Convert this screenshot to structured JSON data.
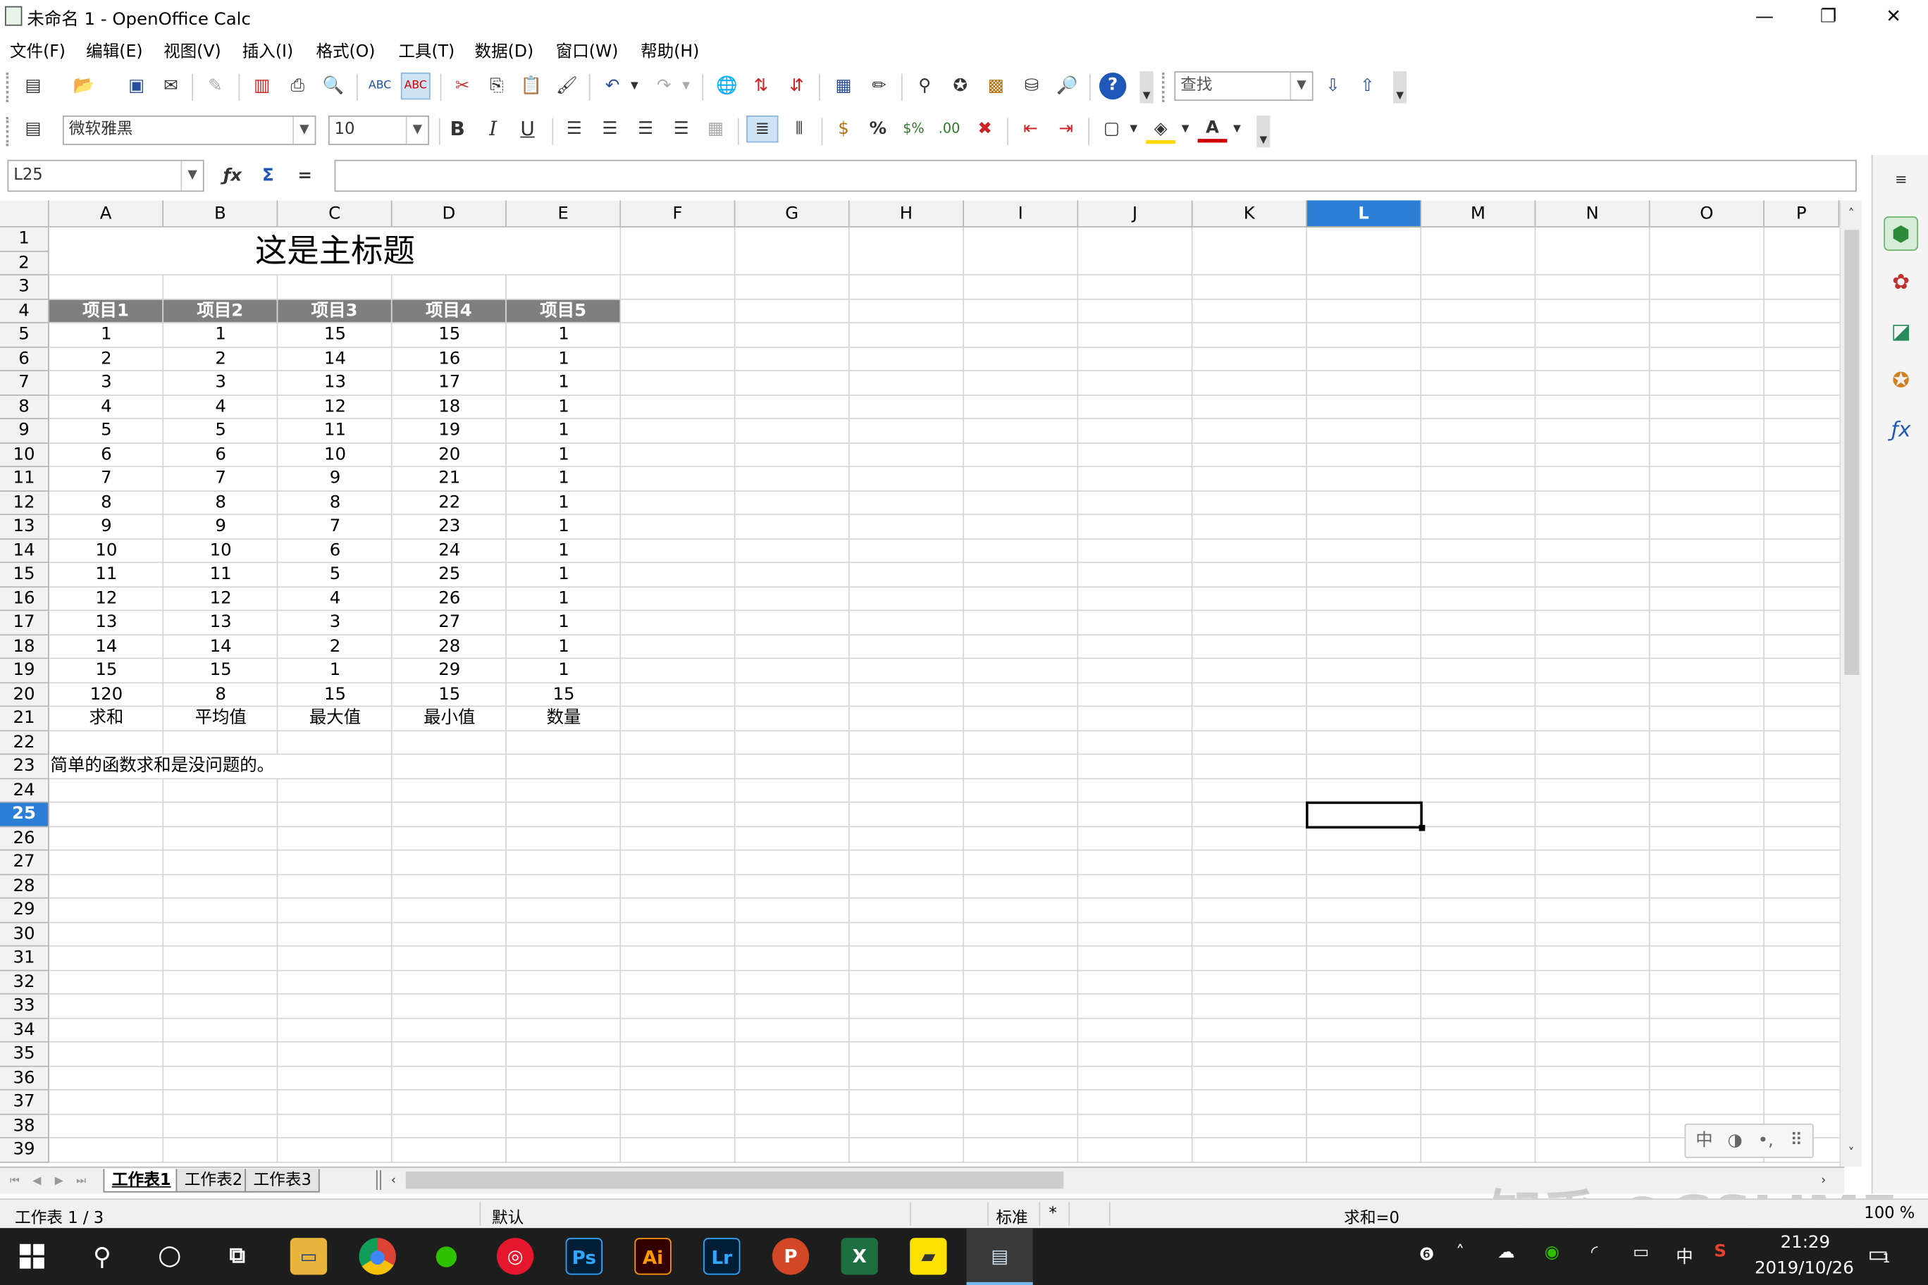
{
  "window": {
    "title": "未命名 1 - OpenOffice Calc",
    "min_label": "—",
    "max_label": "❐",
    "close_label": "✕"
  },
  "menu": [
    "文件(F)",
    "编辑(E)",
    "视图(V)",
    "插入(I)",
    "格式(O)",
    "工具(T)",
    "数据(D)",
    "窗口(W)",
    "帮助(H)"
  ],
  "toolbar": {
    "find_placeholder": "查找",
    "font_name": "微软雅黑",
    "font_size": "10",
    "bold": "B",
    "italic": "I",
    "underline": "U",
    "percent": "%"
  },
  "formula_bar": {
    "cell_ref": "L25",
    "fx": "ƒx",
    "sum": "Σ",
    "equals": "=",
    "value": ""
  },
  "columns": [
    "A",
    "B",
    "C",
    "D",
    "E",
    "F",
    "G",
    "H",
    "I",
    "J",
    "K",
    "L",
    "M",
    "N",
    "O",
    "P"
  ],
  "selected_column": "L",
  "rows": [
    "1",
    "2",
    "3",
    "4",
    "5",
    "6",
    "7",
    "8",
    "9",
    "10",
    "11",
    "12",
    "13",
    "14",
    "15",
    "16",
    "17",
    "18",
    "19",
    "20",
    "21",
    "22",
    "23",
    "24",
    "25",
    "26",
    "27",
    "28",
    "29",
    "30",
    "31",
    "32",
    "33",
    "34",
    "35",
    "36",
    "37",
    "38",
    "39"
  ],
  "selected_row": "25",
  "sheet": {
    "main_title": "这是主标题",
    "headers": [
      "项目1",
      "项目2",
      "项目3",
      "项目4",
      "项目5"
    ],
    "data": [
      [
        "1",
        "1",
        "15",
        "15",
        "1"
      ],
      [
        "2",
        "2",
        "14",
        "16",
        "1"
      ],
      [
        "3",
        "3",
        "13",
        "17",
        "1"
      ],
      [
        "4",
        "4",
        "12",
        "18",
        "1"
      ],
      [
        "5",
        "5",
        "11",
        "19",
        "1"
      ],
      [
        "6",
        "6",
        "10",
        "20",
        "1"
      ],
      [
        "7",
        "7",
        "9",
        "21",
        "1"
      ],
      [
        "8",
        "8",
        "8",
        "22",
        "1"
      ],
      [
        "9",
        "9",
        "7",
        "23",
        "1"
      ],
      [
        "10",
        "10",
        "6",
        "24",
        "1"
      ],
      [
        "11",
        "11",
        "5",
        "25",
        "1"
      ],
      [
        "12",
        "12",
        "4",
        "26",
        "1"
      ],
      [
        "13",
        "13",
        "3",
        "27",
        "1"
      ],
      [
        "14",
        "14",
        "2",
        "28",
        "1"
      ],
      [
        "15",
        "15",
        "1",
        "29",
        "1"
      ]
    ],
    "totals": [
      "120",
      "8",
      "15",
      "15",
      "15"
    ],
    "total_labels": [
      "求和",
      "平均值",
      "最大值",
      "最小值",
      "数量"
    ],
    "note": "简单的函数求和是没问题的。"
  },
  "sheet_tabs": [
    "工作表1",
    "工作表2",
    "工作表3"
  ],
  "active_tab": "工作表1",
  "status": {
    "sheet_info": "工作表 1 / 3",
    "page_style": "默认",
    "mode": "标准",
    "modified": "*",
    "sum": "求和=0",
    "zoom": "100 %"
  },
  "watermark": "知乎 @GSLIME",
  "taskbar": {
    "apps": [
      "Ps",
      "Ai",
      "Lr",
      "P",
      "X"
    ],
    "time": "21:29",
    "date": "2019/10/26",
    "ime": "中",
    "notif_count": "1"
  },
  "colors": {
    "accent": "#2b7fd6",
    "header_fill": "#7f7f7f",
    "taskbar": "#1d1d1d"
  }
}
